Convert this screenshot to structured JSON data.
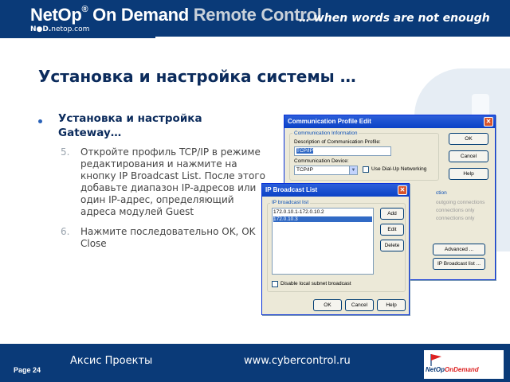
{
  "header": {
    "brand": "NetOp",
    "reg": "®",
    "product_main": " On Demand ",
    "product_accent": "Remote Control",
    "slogan": "… when words are not enough",
    "sub_bold": "N",
    "sub_circle": "●",
    "sub_d": "D.",
    "sub_domain": "netop.com"
  },
  "slide": {
    "title": "Установка и настройка системы …",
    "bullet": "Установка и настройка Gateway…",
    "steps": [
      {
        "num": "5.",
        "text": "Откройте профиль TCP/IP в режиме редактирования и нажмите на кнопку IP Broadcast List. После этого добавьте диапазон IP-адресов или один IP-адрес, определяющий адреса модулей Guest"
      },
      {
        "num": "6.",
        "text": "Нажмите последовательно OK, OK Close"
      }
    ]
  },
  "profile_dialog": {
    "title": "Communication Profile Edit",
    "group_info": "Communication Information",
    "desc_label": "Description of Communication Profile:",
    "desc_value": "TCP/IP",
    "device_label": "Communication Device:",
    "device_value": "TCP/IP",
    "dialup_label": "Use Dial-Up Networking",
    "buttons": {
      "ok": "OK",
      "cancel": "Cancel",
      "help": "Help",
      "advanced": "Advanced ...",
      "ip_broadcast": "IP Broadcast list ..."
    },
    "partial_group": "ction",
    "partial_opts": [
      "outgoing connections",
      "connections only",
      "connections only"
    ]
  },
  "broadcast_dialog": {
    "title": "IP Broadcast List",
    "list_label": "IP broadcast list",
    "items": [
      "172.0.10.1-172.0.10.2",
      "172.0.10.3"
    ],
    "buttons": {
      "add": "Add",
      "edit": "Edit",
      "delete": "Delete",
      "ok": "OK",
      "cancel": "Cancel",
      "help": "Help"
    },
    "disable_label": "Disable local subnet broadcast"
  },
  "footer": {
    "page": "Page 24",
    "company": "Аксис Проекты",
    "url": "www.cybercontrol.ru",
    "logo_a": "NetOp",
    "logo_b": "OnDemand"
  },
  "colors": {
    "banner": "#0a3a78",
    "title_text": "#0b2b5c",
    "xp_titlebar": "#0b42c6",
    "selection": "#316ac5"
  }
}
